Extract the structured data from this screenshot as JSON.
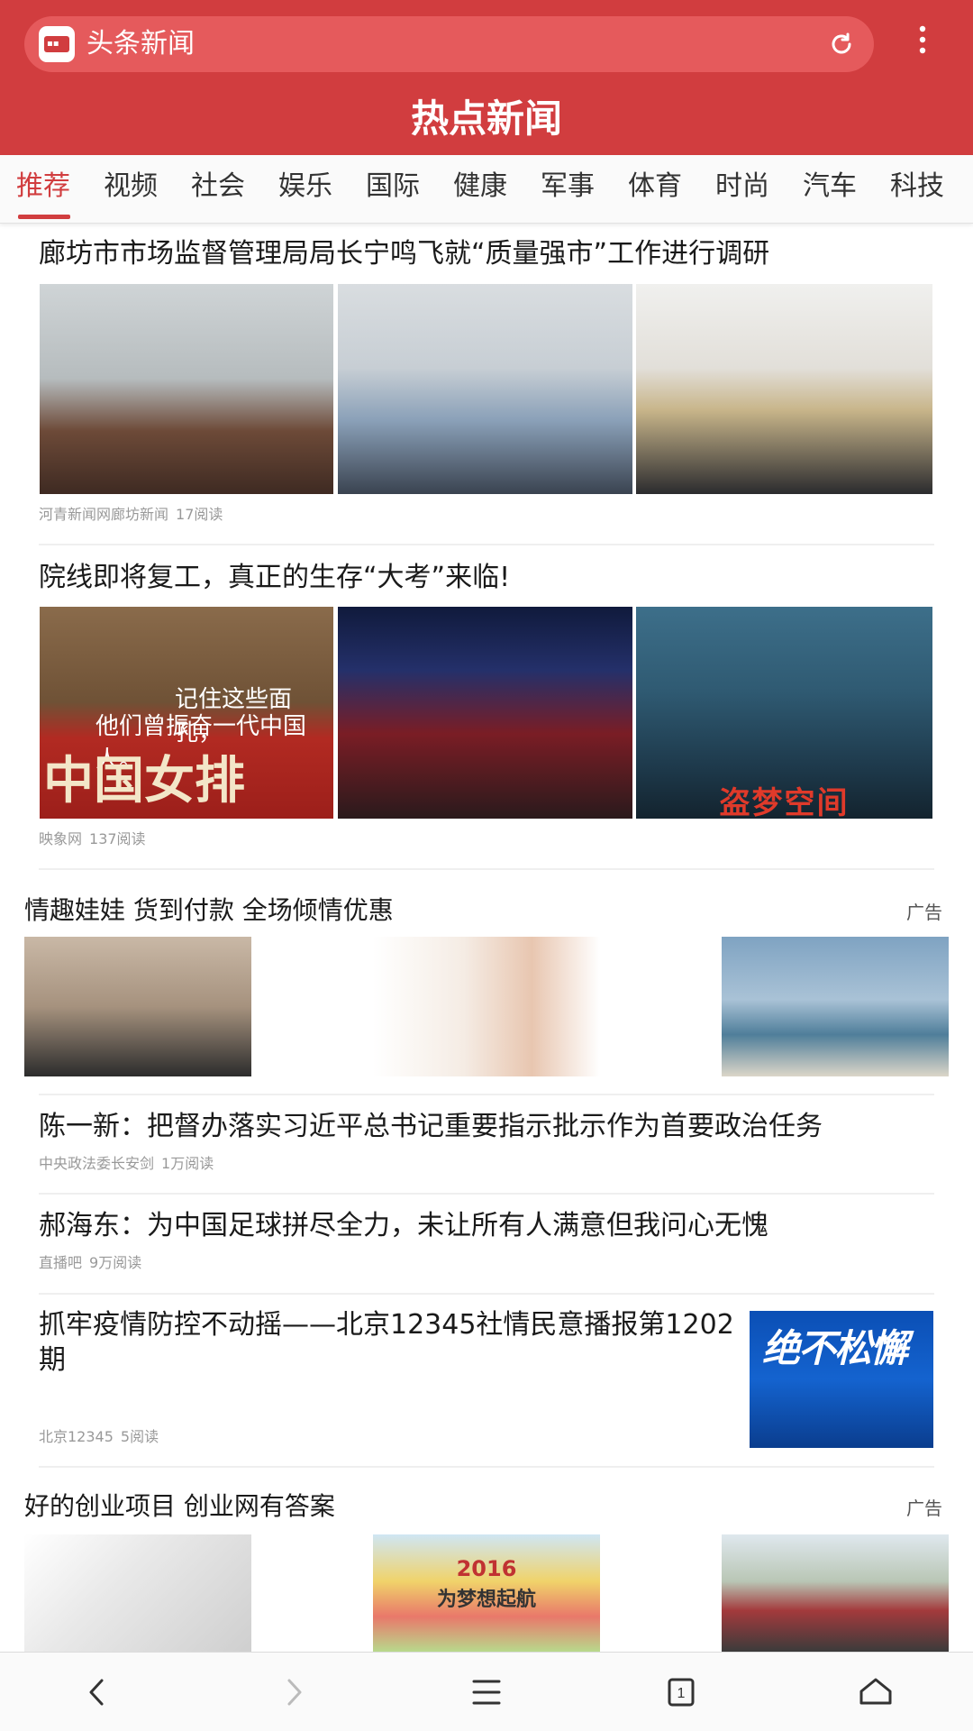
{
  "header": {
    "app_name": "头条新闻",
    "page_title": "热点新闻"
  },
  "tabs": [
    "推荐",
    "视频",
    "社会",
    "娱乐",
    "国际",
    "健康",
    "军事",
    "体育",
    "时尚",
    "汽车",
    "科技"
  ],
  "active_tab": "推荐",
  "feed": {
    "article1": {
      "title": "廊坊市市场监督管理局局长宁鸣飞就“质量强市”工作进行调研",
      "source": "河青新闻网廊坊新闻",
      "reads": "17阅读"
    },
    "article2": {
      "title": "院线即将复工，真正的生存“大考”来临!",
      "source": "映象网",
      "reads": "137阅读",
      "image1_text_line1": "记住这些面孔，",
      "image1_text_line2": "他们曾振奋一代中国人。",
      "image1_big_text": "中国女排",
      "image3_text": "盗梦空间"
    },
    "ad1": {
      "title": "情趣娃娃 货到付款 全场倾情优惠",
      "tag": "广告"
    },
    "article3": {
      "title": "陈一新：把督办落实习近平总书记重要指示批示作为首要政治任务",
      "source": "中央政法委长安剑",
      "reads": "1万阅读"
    },
    "article4": {
      "title": "郝海东：为中国足球拼尽全力，未让所有人满意但我问心无愧",
      "source": "直播吧",
      "reads": "9万阅读"
    },
    "article5": {
      "title_line1": "抓牢疫情防控不动摇——北京12345社情民意播报第1202",
      "title_line2": "期",
      "source": "北京12345",
      "reads": "5阅读",
      "image_text": "绝不松懈"
    },
    "ad2": {
      "title": "好的创业项目 创业网有答案",
      "tag": "广告",
      "image2_year": "2016",
      "image2_motto": "为梦想起航"
    }
  },
  "bottom_nav": {
    "tab_count": "1"
  },
  "colors": {
    "brand_red": "#d13d3f",
    "searchbar_red": "#e55a5c",
    "meta_gray": "#999999"
  },
  "icons": [
    "app-logo-icon",
    "refresh-icon",
    "more-vert-icon",
    "back-icon",
    "forward-icon",
    "menu-icon",
    "tabs-icon",
    "home-icon"
  ]
}
